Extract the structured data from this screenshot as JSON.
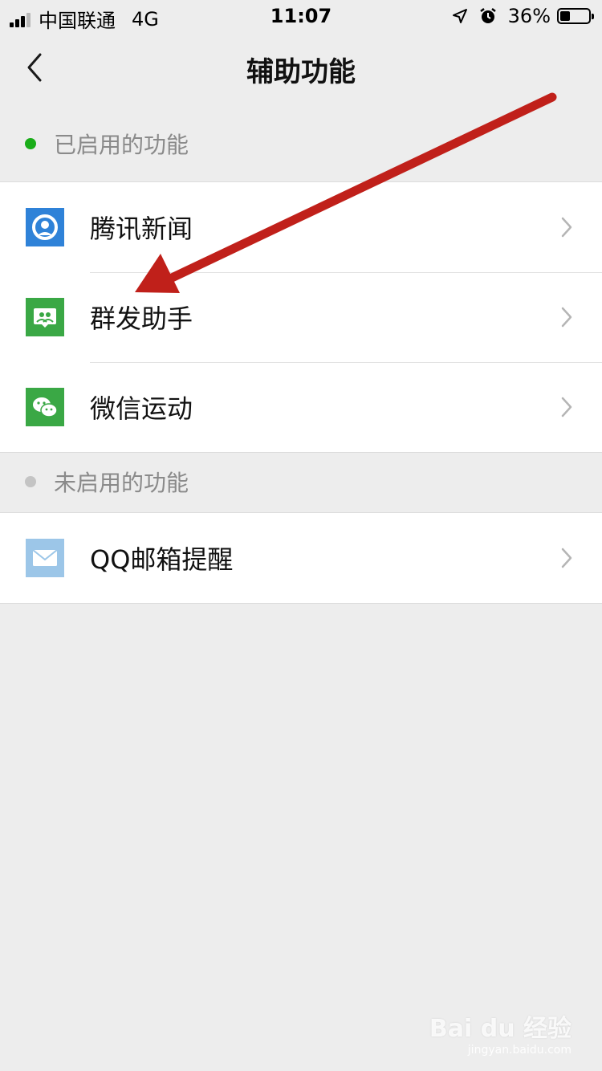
{
  "status_bar": {
    "carrier": "中国联通",
    "network": "4G",
    "time": "11:07",
    "battery_percent": "36%",
    "battery_fill": 0.36
  },
  "nav": {
    "title": "辅助功能"
  },
  "sections": {
    "enabled": {
      "label": "已启用的功能",
      "dot_color": "#1aad19",
      "items": [
        {
          "label": "腾讯新闻",
          "icon": "tencent-news-icon",
          "color": "#2f82d8"
        },
        {
          "label": "群发助手",
          "icon": "mass-message-icon",
          "color": "#3aa845"
        },
        {
          "label": "微信运动",
          "icon": "wechat-icon",
          "color": "#3aa845"
        }
      ]
    },
    "disabled": {
      "label": "未启用的功能",
      "dot_color": "#c4c4c4",
      "items": [
        {
          "label": "QQ邮箱提醒",
          "icon": "mail-icon",
          "color": "#9cc6e8"
        }
      ]
    }
  },
  "annotation": {
    "arrow_color": "#c0201a"
  },
  "watermark": {
    "main": "Bai du 经验",
    "sub": "jingyan.baidu.com"
  }
}
